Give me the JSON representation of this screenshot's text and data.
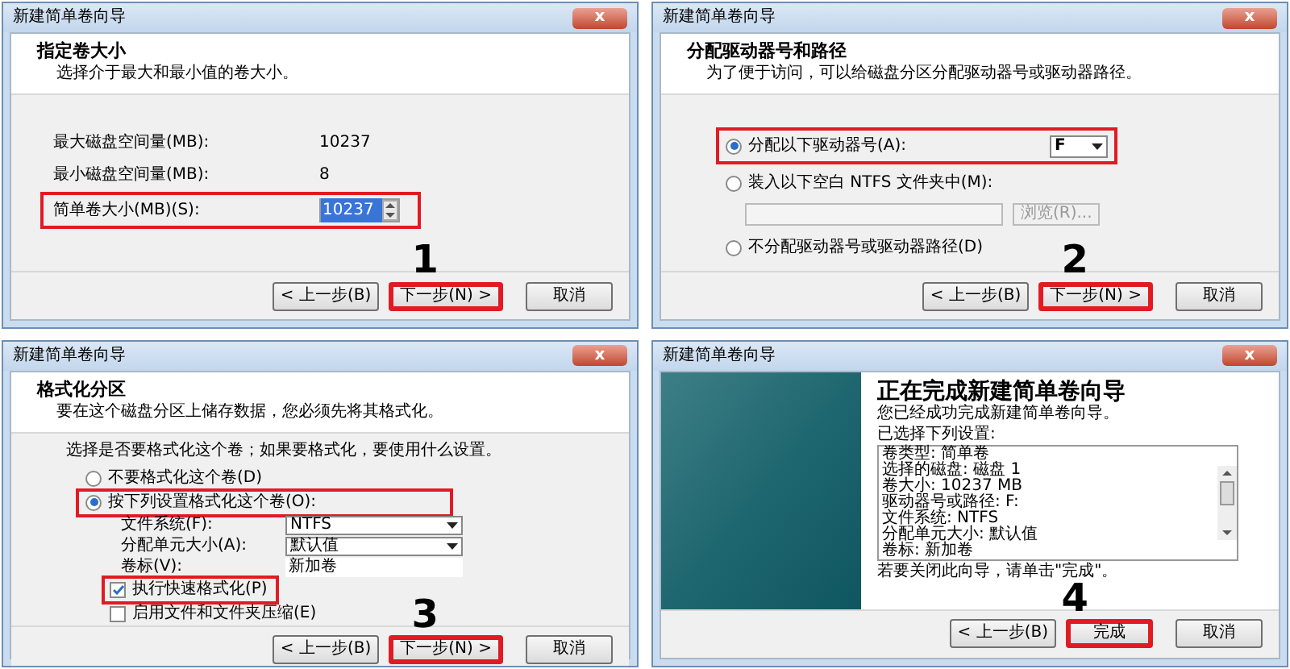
{
  "dialogs": [
    {
      "kind": "size",
      "title": "新建简单卷向导",
      "close": "x",
      "heading": "指定卷大小",
      "subheading": "选择介于最大和最小值的卷大小。",
      "rows": [
        {
          "label": "最大磁盘空间量(MB):",
          "value": "10237"
        },
        {
          "label": "最小磁盘空间量(MB):",
          "value": "8"
        }
      ],
      "size_field": {
        "label": "简单卷大小(MB)(S):",
        "value": "10237",
        "highlighted": true
      },
      "step": "1",
      "buttons": [
        {
          "label": "< 上一步(B)",
          "highlighted": false
        },
        {
          "label": "下一步(N) >",
          "highlighted": true
        },
        {
          "label": "取消",
          "highlighted": false
        }
      ]
    },
    {
      "kind": "drive",
      "title": "新建简单卷向导",
      "close": "x",
      "heading": "分配驱动器号和路径",
      "subheading": "为了便于访问，可以给磁盘分区分配驱动器号或驱动器路径。",
      "options": [
        {
          "label": "分配以下驱动器号(A):",
          "selected": true,
          "highlighted": true,
          "dropdown": "F"
        },
        {
          "label": "装入以下空白 NTFS 文件夹中(M):",
          "selected": false,
          "highlighted": false,
          "browse": "浏览(R)..."
        },
        {
          "label": "不分配驱动器号或驱动器路径(D)",
          "selected": false,
          "highlighted": false
        }
      ],
      "step": "2",
      "buttons": [
        {
          "label": "< 上一步(B)",
          "highlighted": false
        },
        {
          "label": "下一步(N) >",
          "highlighted": true
        },
        {
          "label": "取消",
          "highlighted": false
        }
      ]
    },
    {
      "kind": "format",
      "title": "新建简单卷向导",
      "close": "x",
      "heading": "格式化分区",
      "subheading": "要在这个磁盘分区上储存数据，您必须先将其格式化。",
      "prompt": "选择是否要格式化这个卷；如果要格式化，要使用什么设置。",
      "options": [
        {
          "label": "不要格式化这个卷(D)",
          "selected": false,
          "highlighted": false
        },
        {
          "label": "按下列设置格式化这个卷(O):",
          "selected": true,
          "highlighted": true
        }
      ],
      "fields": [
        {
          "label": "文件系统(F):",
          "value": "NTFS",
          "kind": "dropdown"
        },
        {
          "label": "分配单元大小(A):",
          "value": "默认值",
          "kind": "dropdown"
        },
        {
          "label": "卷标(V):",
          "value": "新加卷",
          "kind": "text"
        }
      ],
      "checkboxes": [
        {
          "label": "执行快速格式化(P)",
          "checked": true,
          "highlighted": true
        },
        {
          "label": "启用文件和文件夹压缩(E)",
          "checked": false,
          "highlighted": false
        }
      ],
      "step": "3",
      "buttons": [
        {
          "label": "< 上一步(B)",
          "highlighted": false
        },
        {
          "label": "下一步(N) >",
          "highlighted": true
        },
        {
          "label": "取消",
          "highlighted": false
        }
      ]
    },
    {
      "kind": "finish",
      "title": "新建简单卷向导",
      "close": "x",
      "heading": "正在完成新建简单卷向导",
      "message": "您已经成功完成新建简单卷向导。",
      "list_label": "已选择下列设置:",
      "settings": [
        "卷类型: 简单卷",
        "选择的磁盘: 磁盘 1",
        "卷大小: 10237 MB",
        "驱动器号或路径: F:",
        "文件系统: NTFS",
        "分配单元大小: 默认值",
        "卷标: 新加卷"
      ],
      "closing": "若要关闭此向导，请单击\"完成\"。",
      "step": "4",
      "buttons": [
        {
          "label": "< 上一步(B)",
          "highlighted": false
        },
        {
          "label": "完成",
          "highlighted": true
        },
        {
          "label": "取消",
          "highlighted": false
        }
      ]
    }
  ]
}
